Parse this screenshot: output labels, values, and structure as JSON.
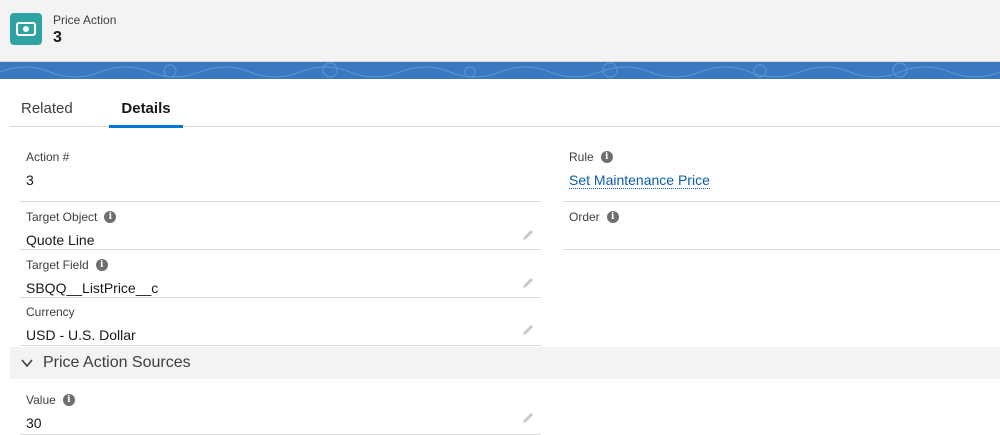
{
  "header": {
    "object_label": "Price Action",
    "record_name": "3",
    "icon": "money-icon"
  },
  "tabs": [
    {
      "label": "Related",
      "active": false
    },
    {
      "label": "Details",
      "active": true
    }
  ],
  "fields": {
    "action_number": {
      "label": "Action #",
      "value": "3"
    },
    "target_object": {
      "label": "Target Object",
      "value": "Quote Line"
    },
    "target_field": {
      "label": "Target Field",
      "value": "SBQQ__ListPrice__c"
    },
    "currency": {
      "label": "Currency",
      "value": "USD - U.S. Dollar"
    },
    "rule": {
      "label": "Rule",
      "value": "Set Maintenance Price"
    },
    "order": {
      "label": "Order",
      "value": ""
    }
  },
  "section": {
    "title": "Price Action Sources",
    "expanded": true,
    "icon": "chevron-down-icon"
  },
  "section_fields": {
    "value": {
      "label": "Value",
      "value": "30"
    }
  },
  "colors": {
    "accent": "#0176d3",
    "icon_bg": "#2ea3a3",
    "banner": "#3b78c0",
    "link": "#0b5cab"
  }
}
